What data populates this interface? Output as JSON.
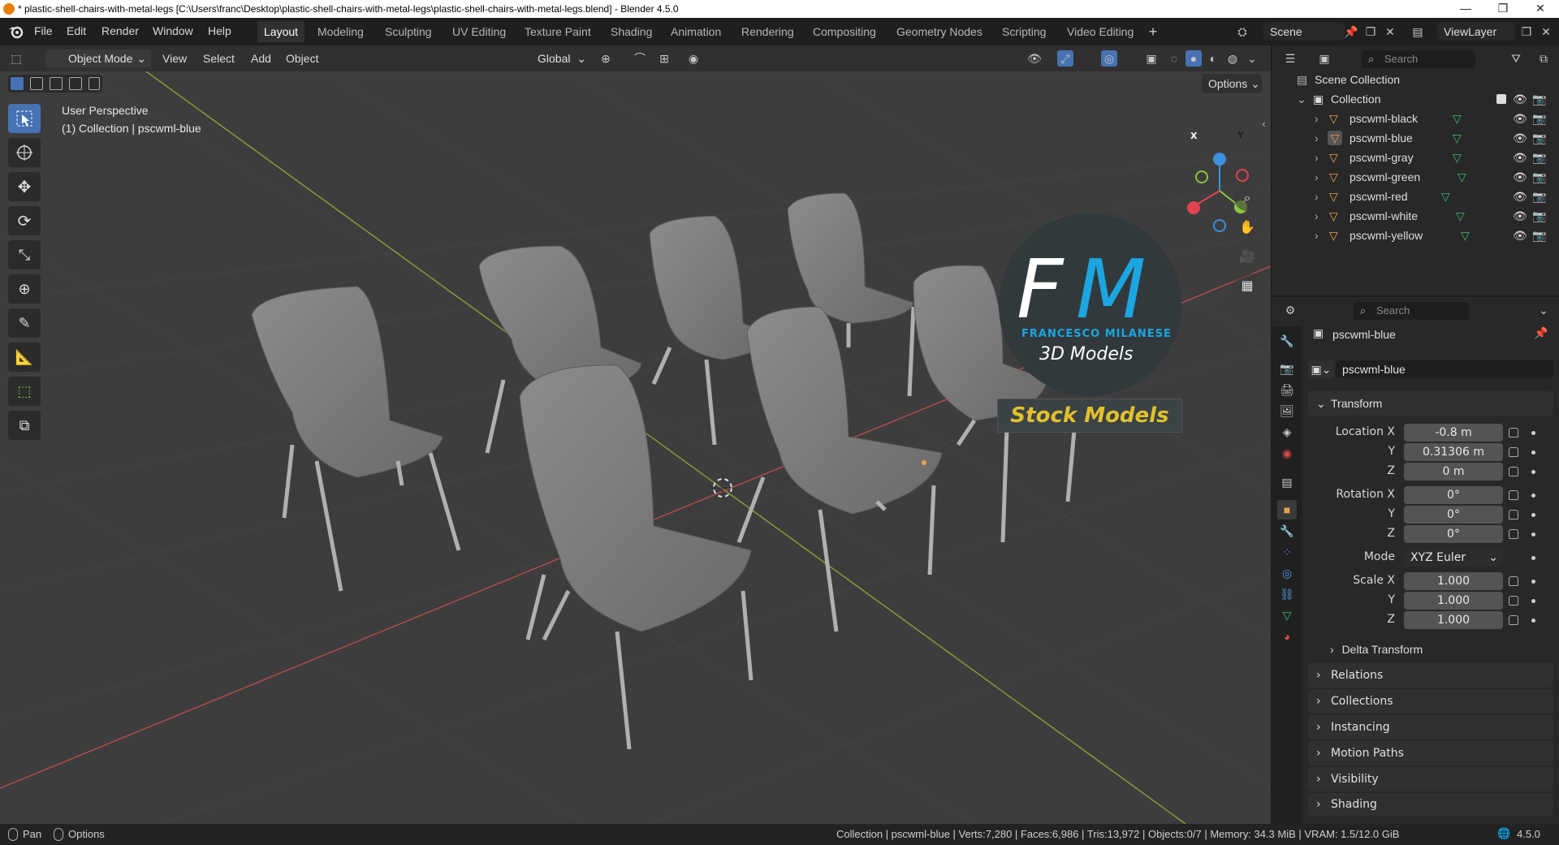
{
  "window": {
    "title": "* plastic-shell-chairs-with-metal-legs [C:\\Users\\franc\\Desktop\\plastic-shell-chairs-with-metal-legs\\plastic-shell-chairs-with-metal-legs.blend] - Blender 4.5.0",
    "minimize": "—",
    "maximize": "❐",
    "close": "✕"
  },
  "menu": {
    "items": [
      "File",
      "Edit",
      "Render",
      "Window",
      "Help"
    ]
  },
  "workspaces": [
    "Layout",
    "Modeling",
    "Sculpting",
    "UV Editing",
    "Texture Paint",
    "Shading",
    "Animation",
    "Rendering",
    "Compositing",
    "Geometry Nodes",
    "Scripting",
    "Video Editing"
  ],
  "scene": {
    "name": "Scene",
    "view_layer": "ViewLayer"
  },
  "viewport_header": {
    "mode": "Object Mode",
    "menus": [
      "View",
      "Select",
      "Add",
      "Object"
    ],
    "orientation": "Global",
    "options": "Options"
  },
  "viewport": {
    "perspective": "User Perspective",
    "collection_info": "(1) Collection | pscwml-blue",
    "watermark": {
      "initials_f": "F",
      "initials_m": "M",
      "name": "FRANCESCO MILANESE",
      "sub": "3D Models",
      "banner": "Stock Models"
    },
    "gizmo": {
      "x": "X",
      "y": "Y",
      "z": "Z"
    }
  },
  "outliner": {
    "search_placeholder": "Search",
    "scene_collection": "Scene Collection",
    "collection": "Collection",
    "objects": [
      "pscwml-black",
      "pscwml-blue",
      "pscwml-gray",
      "pscwml-green",
      "pscwml-red",
      "pscwml-white",
      "pscwml-yellow"
    ]
  },
  "properties": {
    "search_placeholder": "Search",
    "object_name": "pscwml-blue",
    "object_field": "pscwml-blue",
    "transform_header": "Transform",
    "location_label": "Location X",
    "rotation_label": "Rotation X",
    "scale_label": "Scale X",
    "y_label": "Y",
    "z_label": "Z",
    "mode_label": "Mode",
    "location": [
      "-0.8 m",
      "0.31306 m",
      "0 m"
    ],
    "rotation": [
      "0°",
      "0°",
      "0°"
    ],
    "mode": "XYZ Euler",
    "scale": [
      "1.000",
      "1.000",
      "1.000"
    ],
    "delta_transform": "Delta Transform",
    "panels": [
      "Relations",
      "Collections",
      "Instancing",
      "Motion Paths",
      "Visibility",
      "Shading"
    ]
  },
  "status": {
    "pan": "Pan",
    "options": "Options",
    "stats": "Collection | pscwml-blue | Verts:7,280 | Faces:6,986 | Tris:13,972 | Objects:0/7 | Memory: 34.3 MiB | VRAM: 1.5/12.0 GiB",
    "version": "4.5.0"
  },
  "colors": {
    "accent": "#4772b3",
    "x_axis": "#e0434f",
    "y_axis": "#8cc63f",
    "z_axis": "#3d8fe0",
    "object_orange": "#e8a44e"
  }
}
